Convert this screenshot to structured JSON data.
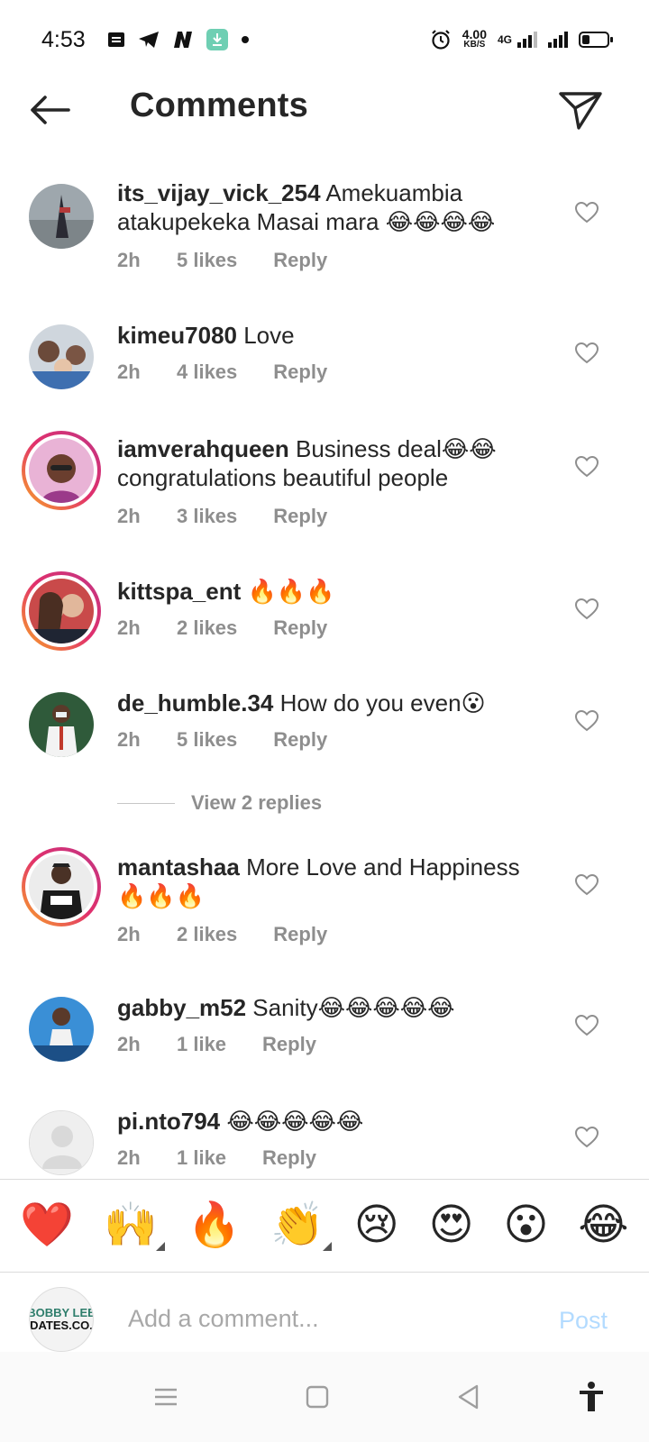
{
  "status": {
    "time": "4:53",
    "speed_value": "4.00",
    "speed_unit": "KB/S",
    "network": "4G",
    "battery_level": 0.3
  },
  "header": {
    "title": "Comments"
  },
  "comments": [
    {
      "username": "its_vijay_vick_254",
      "text": " Amekuambia atakupekeka Masai mara 😂😂😂😂",
      "time": "2h",
      "likes": "5 likes",
      "reply": "Reply"
    },
    {
      "username": "kimeu7080",
      "text": " Love",
      "time": "2h",
      "likes": "4 likes",
      "reply": "Reply"
    },
    {
      "username": "iamverahqueen",
      "text": " Business deal😂😂 congratulations beautiful people",
      "time": "2h",
      "likes": "3 likes",
      "reply": "Reply"
    },
    {
      "username": "kittspa_ent",
      "text": " 🔥🔥🔥",
      "time": "2h",
      "likes": "2 likes",
      "reply": "Reply"
    },
    {
      "username": "de_humble.34",
      "text": " How do you even😮",
      "time": "2h",
      "likes": "5 likes",
      "reply": "Reply"
    },
    {
      "username": "mantashaa",
      "text": " More Love and Happiness 🔥🔥🔥",
      "time": "2h",
      "likes": "2 likes",
      "reply": "Reply"
    },
    {
      "username": "gabby_m52",
      "text": " Sanity😂😂😂😂😂",
      "time": "2h",
      "likes": "1 like",
      "reply": "Reply"
    },
    {
      "username": "pi.nto794",
      "text": " 😂😂😂😂😂",
      "time": "2h",
      "likes": "1 like",
      "reply": "Reply"
    }
  ],
  "view_replies": "View 2 replies",
  "emoji_bar": [
    "❤️",
    "🙌",
    "🔥",
    "👏",
    "😢",
    "😍",
    "😮",
    "😂"
  ],
  "composer": {
    "avatar_line1": "BOBBY LEE",
    "avatar_line2": "UPDATES.CO.KE",
    "placeholder": "Add a comment...",
    "post_label": "Post"
  },
  "colors": {
    "text": "#262626",
    "muted": "#8e8e8e",
    "post_disabled": "#b3dbff",
    "story_ring_start": "#f9a825",
    "story_ring_end": "#c13584"
  }
}
